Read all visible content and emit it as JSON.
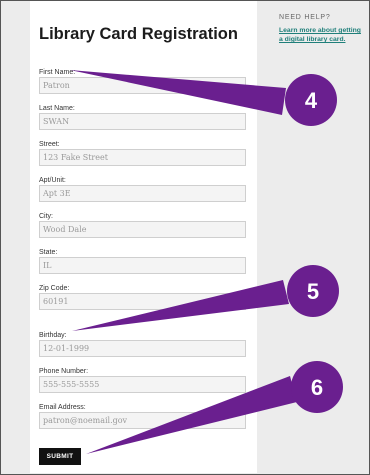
{
  "form": {
    "title": "Library Card Registration",
    "fields": [
      {
        "label": "First Name:",
        "value": "",
        "placeholder": "Patron"
      },
      {
        "label": "Last Name:",
        "value": "",
        "placeholder": "SWAN"
      },
      {
        "label": "Street:",
        "value": "",
        "placeholder": "123 Fake Street"
      },
      {
        "label": "Apt/Unit:",
        "value": "",
        "placeholder": "Apt 3E"
      },
      {
        "label": "City:",
        "value": "",
        "placeholder": "Wood Dale"
      },
      {
        "label": "State:",
        "value": "",
        "placeholder": "IL"
      },
      {
        "label": "Zip Code:",
        "value": "",
        "placeholder": "60191"
      },
      {
        "label": "Birthday:",
        "value": "",
        "placeholder": "12-01-1999"
      },
      {
        "label": "Phone Number:",
        "value": "",
        "placeholder": "555-555-5555"
      },
      {
        "label": "Email Address:",
        "value": "",
        "placeholder": "patron@noemail.gov"
      }
    ],
    "submit_label": "SUBMIT"
  },
  "help": {
    "heading": "NEED HELP?",
    "link_text": "Learn more about getting a digital library card."
  },
  "annotations": {
    "color": "#6a1f8f",
    "callouts": [
      {
        "number": "4"
      },
      {
        "number": "5"
      },
      {
        "number": "6"
      }
    ]
  }
}
